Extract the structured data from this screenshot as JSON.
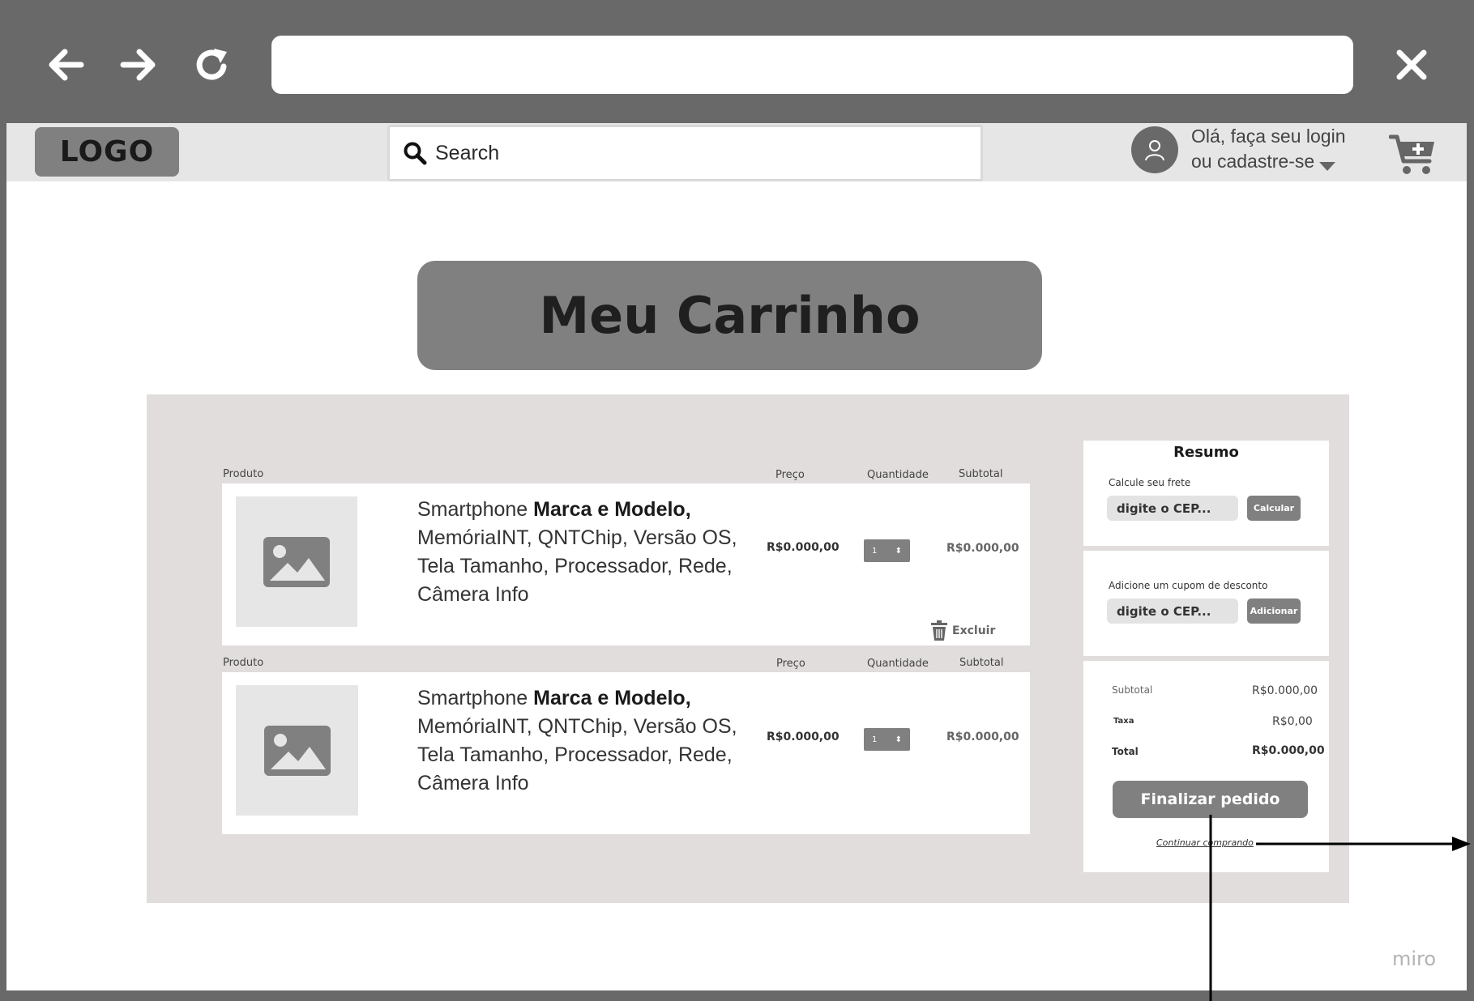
{
  "browser": {
    "back_icon": "arrow-left-icon",
    "forward_icon": "arrow-right-icon",
    "reload_icon": "reload-icon",
    "close_icon": "close-icon",
    "url": ""
  },
  "header": {
    "logo": "LOGO",
    "search_placeholder": "Search",
    "login_line1": "Olá, faça seu login",
    "login_line2": "ou cadastre-se",
    "cart_icon": "cart-add-icon"
  },
  "page_title": "Meu Carrinho",
  "cart": {
    "columns": {
      "product": "Produto",
      "price": "Preço",
      "quantity": "Quantidade",
      "subtotal": "Subtotal"
    },
    "items": [
      {
        "desc_prefix": "Smartphone ",
        "desc_bold": "Marca e Modelo,",
        "desc_line2": "MemóriaINT, QNTChip, Versão OS,",
        "desc_line3": "Tela Tamanho, Processador, Rede,",
        "desc_line4": "Câmera Info",
        "price": "R$0.000,00",
        "quantity": "1",
        "subtotal": "R$0.000,00",
        "delete_label": "Excluir"
      },
      {
        "desc_prefix": "Smartphone ",
        "desc_bold": "Marca e Modelo,",
        "desc_line2": "MemóriaINT, QNTChip, Versão OS,",
        "desc_line3": "Tela Tamanho, Processador, Rede,",
        "desc_line4": "Câmera Info",
        "price": "R$0.000,00",
        "quantity": "1",
        "subtotal": "R$0.000,00"
      }
    ]
  },
  "summary": {
    "title": "Resumo",
    "shipping_label": "Calcule seu frete",
    "shipping_placeholder": "digite o CEP...",
    "shipping_button": "Calcular",
    "coupon_label": "Adicione um cupom de desconto",
    "coupon_placeholder": "digite o CEP...",
    "coupon_button": "Adicionar",
    "subtotal_label": "Subtotal",
    "subtotal_value": "R$0.000,00",
    "tax_label": "Taxa",
    "tax_value": "R$0,00",
    "total_label": "Total",
    "total_value": "R$0.000,00",
    "checkout_button": "Finalizar pedido",
    "continue_link": "Continuar comprando"
  },
  "watermark": "miro"
}
